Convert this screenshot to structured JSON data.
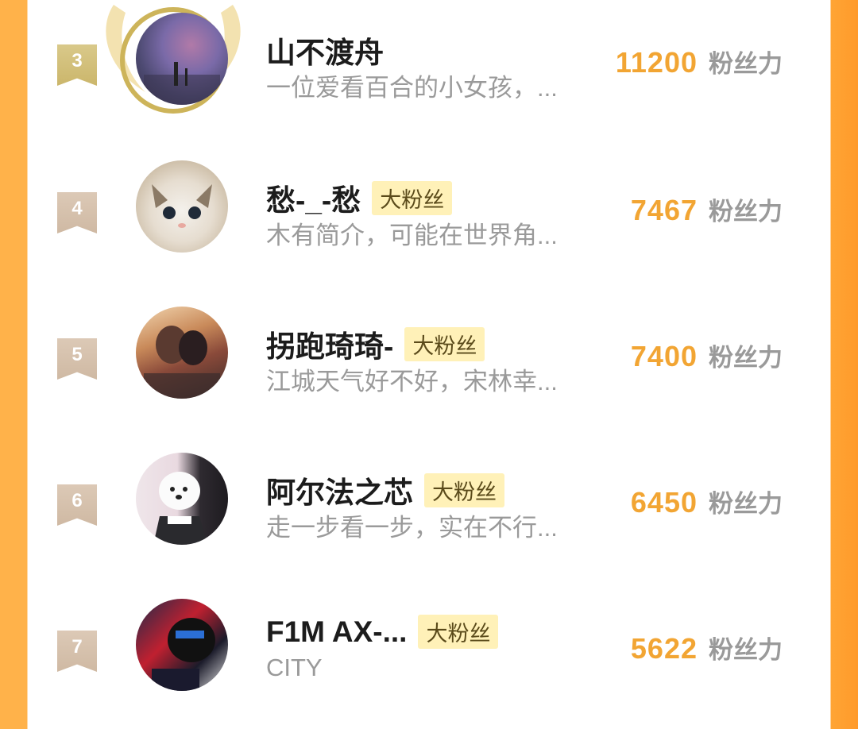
{
  "colors": {
    "score": "#f2a533",
    "badge_bg": "#fff1b8",
    "side_accent": "#ffa535"
  },
  "ranking": [
    {
      "rank": "3",
      "name": "山不渡舟",
      "badge": "",
      "desc": "一位爱看百合的小女孩，...",
      "score": "11200",
      "unit": "粉丝力"
    },
    {
      "rank": "4",
      "name": "愁-_-愁",
      "badge": "大粉丝",
      "desc": "木有简介，可能在世界角...",
      "score": "7467",
      "unit": "粉丝力"
    },
    {
      "rank": "5",
      "name": "拐跑琦琦-",
      "badge": "大粉丝",
      "desc": "江城天气好不好，宋林幸...",
      "score": "7400",
      "unit": "粉丝力"
    },
    {
      "rank": "6",
      "name": "阿尔法之芯",
      "badge": "大粉丝",
      "desc": "走一步看一步，实在不行...",
      "score": "6450",
      "unit": "粉丝力"
    },
    {
      "rank": "7",
      "name": "F1M AX-...",
      "badge": "大粉丝",
      "desc": "CITY",
      "score": "5622",
      "unit": "粉丝力"
    }
  ]
}
